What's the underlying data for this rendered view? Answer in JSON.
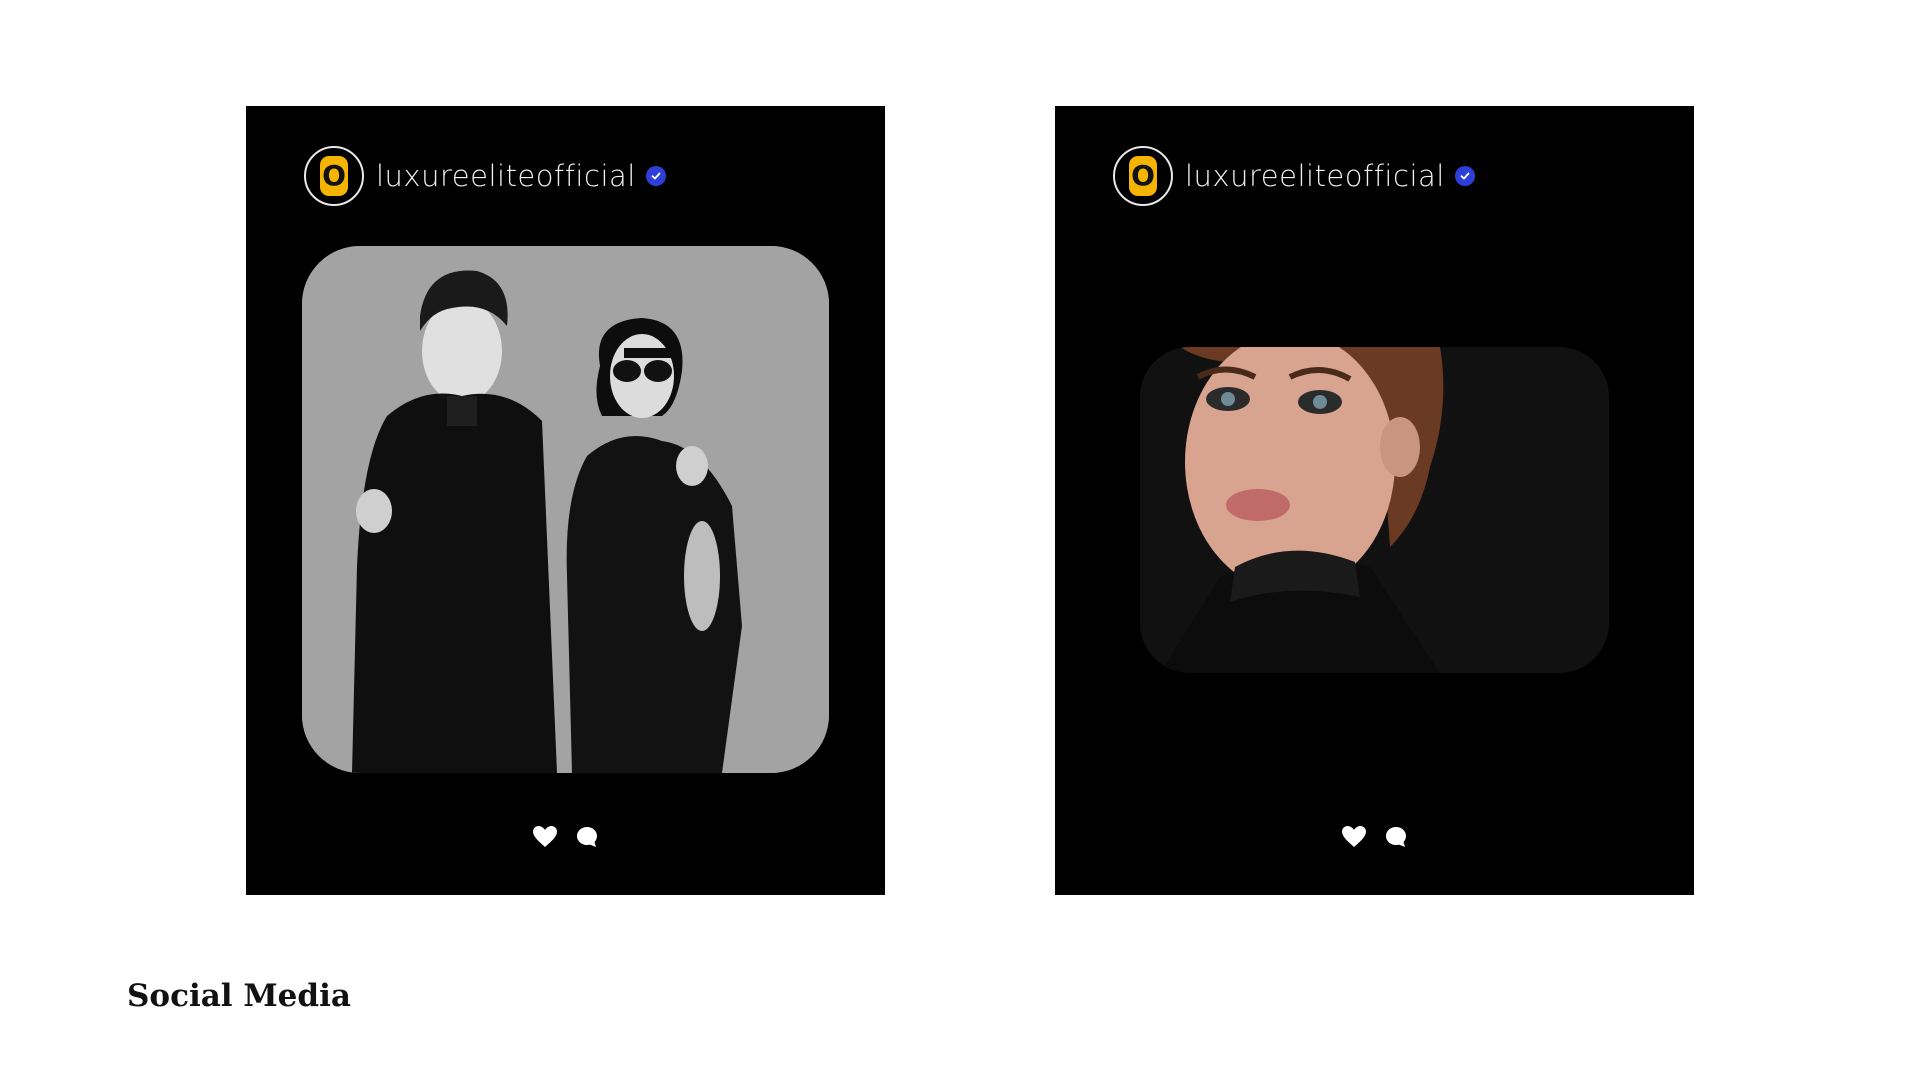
{
  "posts": [
    {
      "username": "luxureeliteofficial",
      "avatar_letter": "O",
      "photo_description": "black-and-white fashion photo of a man and a woman in sunglasses"
    },
    {
      "username": "luxureeliteofficial",
      "avatar_letter": "O",
      "photo_description": "close-up beauty portrait of a woman with red hair looking up"
    }
  ],
  "section_title": "Social Media",
  "colors": {
    "card_background": "#000000",
    "avatar_accent": "#f4b400",
    "verified_badge": "#2e3fd9",
    "page_background": "#ffffff"
  },
  "icons": [
    "heart-icon",
    "comment-icon",
    "verified-badge-icon"
  ]
}
